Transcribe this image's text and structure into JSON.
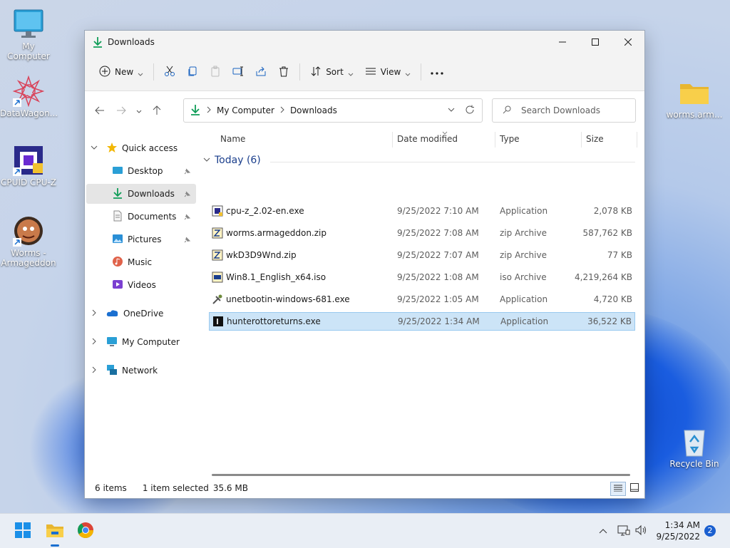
{
  "desktop": {
    "icons": [
      {
        "label": "My Computer"
      },
      {
        "label": "DataWagon..."
      },
      {
        "label": "CPUID CPU-Z"
      },
      {
        "label": "Worms - Armageddon"
      },
      {
        "label": "worms.arm..."
      },
      {
        "label": "Recycle Bin"
      }
    ]
  },
  "window": {
    "title": "Downloads",
    "toolbar": {
      "new_label": "New",
      "sort_label": "Sort",
      "view_label": "View"
    },
    "address": {
      "crumbs": [
        "My Computer",
        "Downloads"
      ],
      "search_placeholder": "Search Downloads"
    },
    "sidebar": {
      "quick_access": "Quick access",
      "items": [
        {
          "label": "Desktop",
          "icon": "desktop-icon",
          "pinned": true
        },
        {
          "label": "Downloads",
          "icon": "download-icon",
          "pinned": true,
          "selected": true
        },
        {
          "label": "Documents",
          "icon": "document-icon",
          "pinned": true
        },
        {
          "label": "Pictures",
          "icon": "picture-icon",
          "pinned": true
        },
        {
          "label": "Music",
          "icon": "music-icon",
          "pinned": false
        },
        {
          "label": "Videos",
          "icon": "video-icon",
          "pinned": false
        }
      ],
      "onedrive": "OneDrive",
      "my_computer": "My Computer",
      "network": "Network"
    },
    "columns": {
      "name": "Name",
      "date": "Date modified",
      "type": "Type",
      "size": "Size"
    },
    "group_label": "Today (6)",
    "files": [
      {
        "name": "cpu-z_2.02-en.exe",
        "date": "9/25/2022 7:10 AM",
        "type": "Application",
        "size": "2,078 KB",
        "icon": "cpuz-app-icon"
      },
      {
        "name": "worms.armageddon.zip",
        "date": "9/25/2022 7:08 AM",
        "type": "zip Archive",
        "size": "587,762 KB",
        "icon": "zip-icon"
      },
      {
        "name": "wkD3D9Wnd.zip",
        "date": "9/25/2022 7:07 AM",
        "type": "zip Archive",
        "size": "77 KB",
        "icon": "zip-icon"
      },
      {
        "name": "Win8.1_English_x64.iso",
        "date": "9/25/2022 1:08 AM",
        "type": "iso Archive",
        "size": "4,219,264 KB",
        "icon": "iso-icon"
      },
      {
        "name": "unetbootin-windows-681.exe",
        "date": "9/25/2022 1:05 AM",
        "type": "Application",
        "size": "4,720 KB",
        "icon": "unetbootin-icon"
      },
      {
        "name": "hunterottoreturns.exe",
        "date": "9/25/2022 1:34 AM",
        "type": "Application",
        "size": "36,522 KB",
        "icon": "hunter-app-icon",
        "selected": true
      }
    ],
    "status": {
      "count": "6 items",
      "selected": "1 item selected",
      "size": "35.6 MB"
    }
  },
  "taskbar": {
    "time": "1:34 AM",
    "date": "9/25/2022",
    "notifications": "2"
  },
  "colors": {
    "accent": "#0067c0",
    "selection": "#cce4f7",
    "folder": "#f8cf4a"
  }
}
